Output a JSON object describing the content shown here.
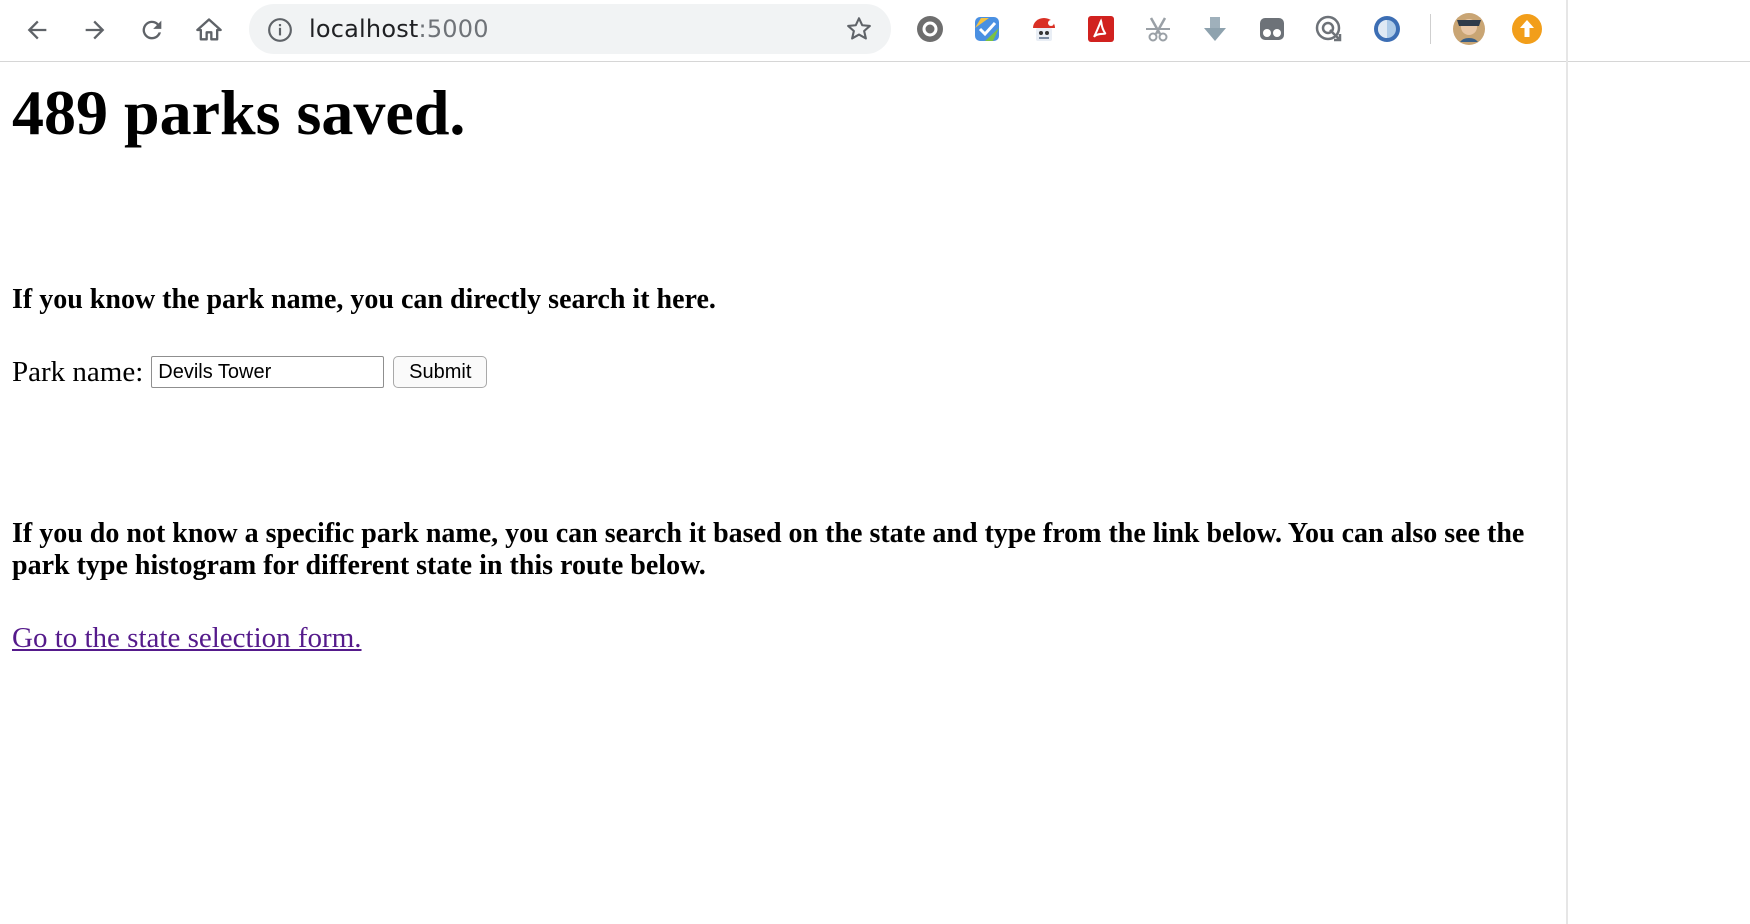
{
  "browser": {
    "url_host": "localhost",
    "url_port": ":5000",
    "icons": {
      "back": "arrow-left-icon",
      "forward": "arrow-right-icon",
      "reload": "reload-icon",
      "home": "home-icon",
      "info": "info-icon",
      "bookmark": "star-icon"
    },
    "extensions": [
      "gray-circle-extension-icon",
      "colorful-checkmark-extension-icon",
      "mascot-extension-icon",
      "acrobat-extension-icon",
      "scissors-extension-icon",
      "download-arrow-extension-icon",
      "puzzle-extension-icon",
      "target-arrow-extension-icon",
      "blue-circle-extension-icon"
    ],
    "profile": "avatar-icon",
    "update": "update-arrow-icon",
    "accent": "#f29e1a"
  },
  "page": {
    "heading": "489 parks saved.",
    "search_prompt": "If you know the park name, you can directly search it here.",
    "form": {
      "label": "Park name:",
      "input_value": "Devils Tower",
      "submit_label": "Submit"
    },
    "browse_prompt": "If you do not know a specific park name, you can search it based on the state and type from the link below. You can also see the park type histogram for different state in this route below.",
    "link_text": "Go to the state selection form."
  },
  "colors": {
    "link_visited": "#551a8b",
    "omnibox_bg": "#f1f3f4"
  }
}
